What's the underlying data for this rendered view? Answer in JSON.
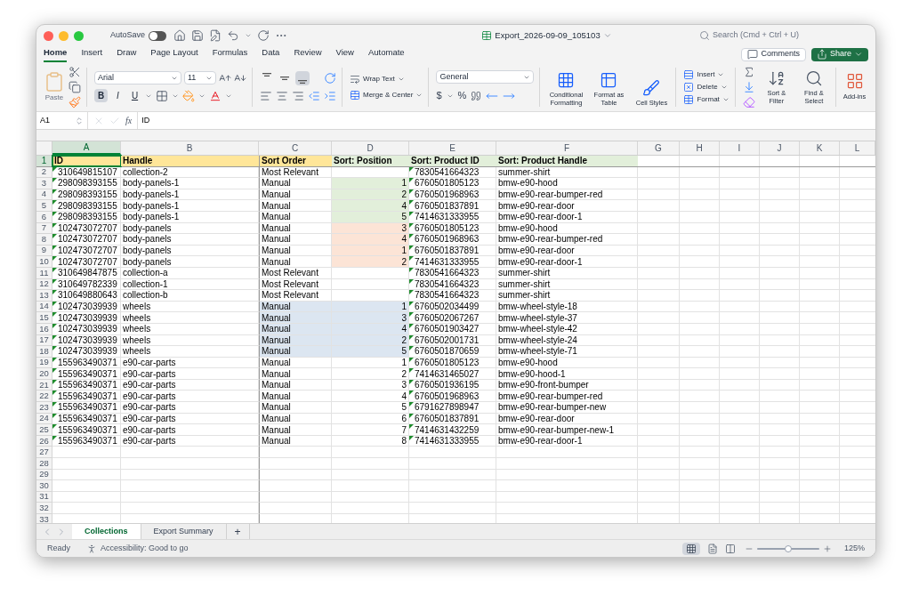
{
  "window": {
    "title": "Export_2026-09-09_105103",
    "autosave_label": "AutoSave",
    "autosave_on": false,
    "search_placeholder": "Search (Cmd + Ctrl + U)"
  },
  "ribbon_tabs": [
    {
      "label": "Home",
      "selected": true
    },
    {
      "label": "Insert",
      "selected": false
    },
    {
      "label": "Draw",
      "selected": false
    },
    {
      "label": "Page Layout",
      "selected": false
    },
    {
      "label": "Formulas",
      "selected": false
    },
    {
      "label": "Data",
      "selected": false
    },
    {
      "label": "Review",
      "selected": false
    },
    {
      "label": "View",
      "selected": false
    },
    {
      "label": "Automate",
      "selected": false
    }
  ],
  "comments_button": "Comments",
  "share_button": "Share",
  "ribbon": {
    "paste_label": "Paste",
    "font_name": "Arial",
    "font_size": "11",
    "font_styles": [
      {
        "label": "B",
        "selected": true
      },
      {
        "label": "I",
        "selected": false
      },
      {
        "label": "U",
        "selected": false
      }
    ],
    "vertical_align": [
      {
        "selected": false
      },
      {
        "selected": false
      },
      {
        "selected": true
      }
    ],
    "wrap_text": "Wrap Text",
    "merge_center": "Merge & Center",
    "number_format": "General",
    "currency": "$",
    "percent": "%",
    "style_buttons": [
      "Conditional Formatting",
      "Format as Table",
      "Cell Styles"
    ],
    "cell_buttons": [
      "Insert",
      "Delete",
      "Format"
    ],
    "edit_buttons": [
      "Sort & Filter",
      "Find & Select"
    ],
    "addins": "Add-ins"
  },
  "formula_bar": {
    "name_box": "A1",
    "fx": "fx",
    "formula": "ID"
  },
  "sheet": {
    "column_letters": [
      {
        "label": "A",
        "selected": true
      },
      {
        "label": "B",
        "selected": false
      },
      {
        "label": "C",
        "selected": false
      },
      {
        "label": "D",
        "selected": false
      },
      {
        "label": "E",
        "selected": false
      },
      {
        "label": "F",
        "selected": false
      },
      {
        "label": "G",
        "selected": false
      },
      {
        "label": "H",
        "selected": false
      },
      {
        "label": "I",
        "selected": false
      },
      {
        "label": "J",
        "selected": false
      },
      {
        "label": "K",
        "selected": false
      },
      {
        "label": "L",
        "selected": false
      }
    ],
    "header_row": {
      "number": "1",
      "selected": true,
      "cells": [
        {
          "text": "ID",
          "color": "#ffe699",
          "kind": "flagged"
        },
        {
          "text": "Handle",
          "color": "#ffe699",
          "kind": "text"
        },
        {
          "text": "Sort Order",
          "color": "#ffe699",
          "kind": "text"
        },
        {
          "text": "Sort: Position",
          "color": "#e2efda",
          "kind": "number"
        },
        {
          "text": "Sort: Product ID",
          "color": "#e2efda",
          "kind": "flagged"
        },
        {
          "text": "Sort: Product Handle",
          "color": "#e2efda",
          "kind": "text"
        }
      ]
    },
    "rows": [
      {
        "number": "2",
        "kind": "plain",
        "cells": [
          "310649815107",
          "collection-2",
          "Most Relevant",
          "",
          "7830541664323",
          "summer-shirt"
        ]
      },
      {
        "number": "3",
        "kind": "position",
        "color": "#e2efda",
        "cells": [
          "298098393155",
          "body-panels-1",
          "Manual",
          "1",
          "6760501805123",
          "bmw-e90-hood"
        ]
      },
      {
        "number": "4",
        "kind": "position",
        "color": "#e2efda",
        "cells": [
          "298098393155",
          "body-panels-1",
          "Manual",
          "2",
          "6760501968963",
          "bmw-e90-rear-bumper-red"
        ]
      },
      {
        "number": "5",
        "kind": "position",
        "color": "#e2efda",
        "cells": [
          "298098393155",
          "body-panels-1",
          "Manual",
          "4",
          "6760501837891",
          "bmw-e90-rear-door"
        ]
      },
      {
        "number": "6",
        "kind": "position",
        "color": "#e2efda",
        "cells": [
          "298098393155",
          "body-panels-1",
          "Manual",
          "5",
          "7414631333955",
          "bmw-e90-rear-door-1"
        ]
      },
      {
        "number": "7",
        "kind": "position",
        "color": "#fce4d6",
        "cells": [
          "102473072707",
          "body-panels",
          "Manual",
          "3",
          "6760501805123",
          "bmw-e90-hood"
        ]
      },
      {
        "number": "8",
        "kind": "position",
        "color": "#fce4d6",
        "cells": [
          "102473072707",
          "body-panels",
          "Manual",
          "4",
          "6760501968963",
          "bmw-e90-rear-bumper-red"
        ]
      },
      {
        "number": "9",
        "kind": "position",
        "color": "#fce4d6",
        "cells": [
          "102473072707",
          "body-panels",
          "Manual",
          "1",
          "6760501837891",
          "bmw-e90-rear-door"
        ]
      },
      {
        "number": "10",
        "kind": "position",
        "color": "#fce4d6",
        "cells": [
          "102473072707",
          "body-panels",
          "Manual",
          "2",
          "7414631333955",
          "bmw-e90-rear-door-1"
        ]
      },
      {
        "number": "11",
        "kind": "plain",
        "cells": [
          "310649847875",
          "collection-a",
          "Most Relevant",
          "",
          "7830541664323",
          "summer-shirt"
        ]
      },
      {
        "number": "12",
        "kind": "plain",
        "cells": [
          "310649782339",
          "collection-1",
          "Most Relevant",
          "",
          "7830541664323",
          "summer-shirt"
        ]
      },
      {
        "number": "13",
        "kind": "plain",
        "cells": [
          "310649880643",
          "collection-b",
          "Most Relevant",
          "",
          "7830541664323",
          "summer-shirt"
        ]
      },
      {
        "number": "14",
        "kind": "order_position",
        "color": "#dce6f1",
        "cells": [
          "102473039939",
          "wheels",
          "Manual",
          "1",
          "6760502034499",
          "bmw-wheel-style-18"
        ]
      },
      {
        "number": "15",
        "kind": "order_position",
        "color": "#dce6f1",
        "cells": [
          "102473039939",
          "wheels",
          "Manual",
          "3",
          "6760502067267",
          "bmw-wheel-style-37"
        ]
      },
      {
        "number": "16",
        "kind": "order_position",
        "color": "#dce6f1",
        "cells": [
          "102473039939",
          "wheels",
          "Manual",
          "4",
          "6760501903427",
          "bmw-wheel-style-42"
        ]
      },
      {
        "number": "17",
        "kind": "order_position",
        "color": "#dce6f1",
        "cells": [
          "102473039939",
          "wheels",
          "Manual",
          "2",
          "6760502001731",
          "bmw-wheel-style-24"
        ]
      },
      {
        "number": "18",
        "kind": "order_position",
        "color": "#dce6f1",
        "cells": [
          "102473039939",
          "wheels",
          "Manual",
          "5",
          "6760501870659",
          "bmw-wheel-style-71"
        ]
      },
      {
        "number": "19",
        "kind": "plain",
        "cells": [
          "155963490371",
          "e90-car-parts",
          "Manual",
          "1",
          "6760501805123",
          "bmw-e90-hood"
        ]
      },
      {
        "number": "20",
        "kind": "plain",
        "cells": [
          "155963490371",
          "e90-car-parts",
          "Manual",
          "2",
          "7414631465027",
          "bmw-e90-hood-1"
        ]
      },
      {
        "number": "21",
        "kind": "plain",
        "cells": [
          "155963490371",
          "e90-car-parts",
          "Manual",
          "3",
          "6760501936195",
          "bmw-e90-front-bumper"
        ]
      },
      {
        "number": "22",
        "kind": "plain",
        "cells": [
          "155963490371",
          "e90-car-parts",
          "Manual",
          "4",
          "6760501968963",
          "bmw-e90-rear-bumper-red"
        ]
      },
      {
        "number": "23",
        "kind": "plain",
        "cells": [
          "155963490371",
          "e90-car-parts",
          "Manual",
          "5",
          "6791627898947",
          "bmw-e90-rear-bumper-new"
        ]
      },
      {
        "number": "24",
        "kind": "plain",
        "cells": [
          "155963490371",
          "e90-car-parts",
          "Manual",
          "6",
          "6760501837891",
          "bmw-e90-rear-door"
        ]
      },
      {
        "number": "25",
        "kind": "plain",
        "cells": [
          "155963490371",
          "e90-car-parts",
          "Manual",
          "7",
          "7414631432259",
          "bmw-e90-rear-bumper-new-1"
        ]
      },
      {
        "number": "26",
        "kind": "plain",
        "cells": [
          "155963490371",
          "e90-car-parts",
          "Manual",
          "8",
          "7414631333955",
          "bmw-e90-rear-door-1"
        ]
      }
    ],
    "empty_rows": [
      "27",
      "28",
      "29",
      "30",
      "31",
      "32",
      "33"
    ]
  },
  "sheet_tabs": [
    {
      "label": "Collections",
      "selected": true
    },
    {
      "label": "Export Summary",
      "selected": false
    }
  ],
  "add_sheet": "+",
  "status_bar": {
    "status": "Ready",
    "accessibility": "Accessibility: Good to go",
    "zoom": "125%",
    "zoom_slider": {
      "level": 0.5
    }
  }
}
